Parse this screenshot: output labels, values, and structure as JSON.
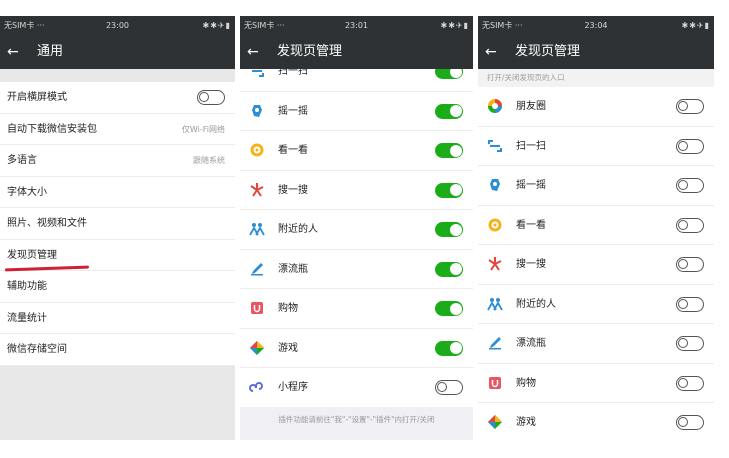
{
  "statusbar": {
    "p1": {
      "sim": "无SIM卡 ···",
      "time": "23:00",
      "icons": "✱✱✈▮"
    },
    "p2": {
      "sim": "无SIM卡 ···",
      "time": "23:01",
      "icons": "✱✱✈▮"
    },
    "p3": {
      "sim": "无SIM卡 ···",
      "time": "23:04",
      "icons": "✱✱✈▮"
    }
  },
  "screen1": {
    "back": "←",
    "title": "通用",
    "rows": [
      {
        "label": "开启横屏模式",
        "toggle": "off"
      },
      {
        "label": "自动下载微信安装包",
        "value": "仅Wi-Fi网络"
      },
      {
        "label": "多语言",
        "value": "跟随系统"
      },
      {
        "label": "字体大小"
      },
      {
        "label": "照片、视频和文件"
      },
      {
        "label": "发现页管理"
      },
      {
        "label": "辅助功能"
      },
      {
        "label": "流量统计"
      },
      {
        "label": "微信存储空间"
      }
    ]
  },
  "screen2": {
    "back": "←",
    "title": "发现页管理",
    "rows": [
      {
        "label": "扫一扫",
        "icon": "scan-icon",
        "toggle": "on"
      },
      {
        "label": "摇一摇",
        "icon": "shake-icon",
        "toggle": "on"
      },
      {
        "label": "看一看",
        "icon": "look-icon",
        "toggle": "on"
      },
      {
        "label": "搜一搜",
        "icon": "search-icon",
        "toggle": "on"
      },
      {
        "label": "附近的人",
        "icon": "people-nearby-icon",
        "toggle": "on"
      },
      {
        "label": "漂流瓶",
        "icon": "drift-bottle-icon",
        "toggle": "on"
      },
      {
        "label": "购物",
        "icon": "shopping-icon",
        "toggle": "on"
      },
      {
        "label": "游戏",
        "icon": "games-icon",
        "toggle": "on"
      },
      {
        "label": "小程序",
        "icon": "mini-program-icon",
        "toggle": "off"
      }
    ],
    "footer": "插件功能请前往\"我\"-\"设置\"-\"插件\"内打开/关闭"
  },
  "screen3": {
    "back": "←",
    "title": "发现页管理",
    "section_label": "打开/关闭发现页的入口",
    "rows": [
      {
        "label": "朋友圈",
        "icon": "moments-icon",
        "toggle": "off"
      },
      {
        "label": "扫一扫",
        "icon": "scan-icon",
        "toggle": "off"
      },
      {
        "label": "摇一摇",
        "icon": "shake-icon",
        "toggle": "off"
      },
      {
        "label": "看一看",
        "icon": "look-icon",
        "toggle": "off"
      },
      {
        "label": "搜一搜",
        "icon": "search-icon",
        "toggle": "off"
      },
      {
        "label": "附近的人",
        "icon": "people-nearby-icon",
        "toggle": "off"
      },
      {
        "label": "漂流瓶",
        "icon": "drift-bottle-icon",
        "toggle": "off"
      },
      {
        "label": "购物",
        "icon": "shopping-icon",
        "toggle": "off"
      },
      {
        "label": "游戏",
        "icon": "games-icon",
        "toggle": "off"
      }
    ]
  },
  "colors": {
    "header_bg": "#2f3234",
    "toggle_on": "#1aad19",
    "highlight_underline": "#cf2133",
    "page_bg": "#e8e8e8"
  }
}
